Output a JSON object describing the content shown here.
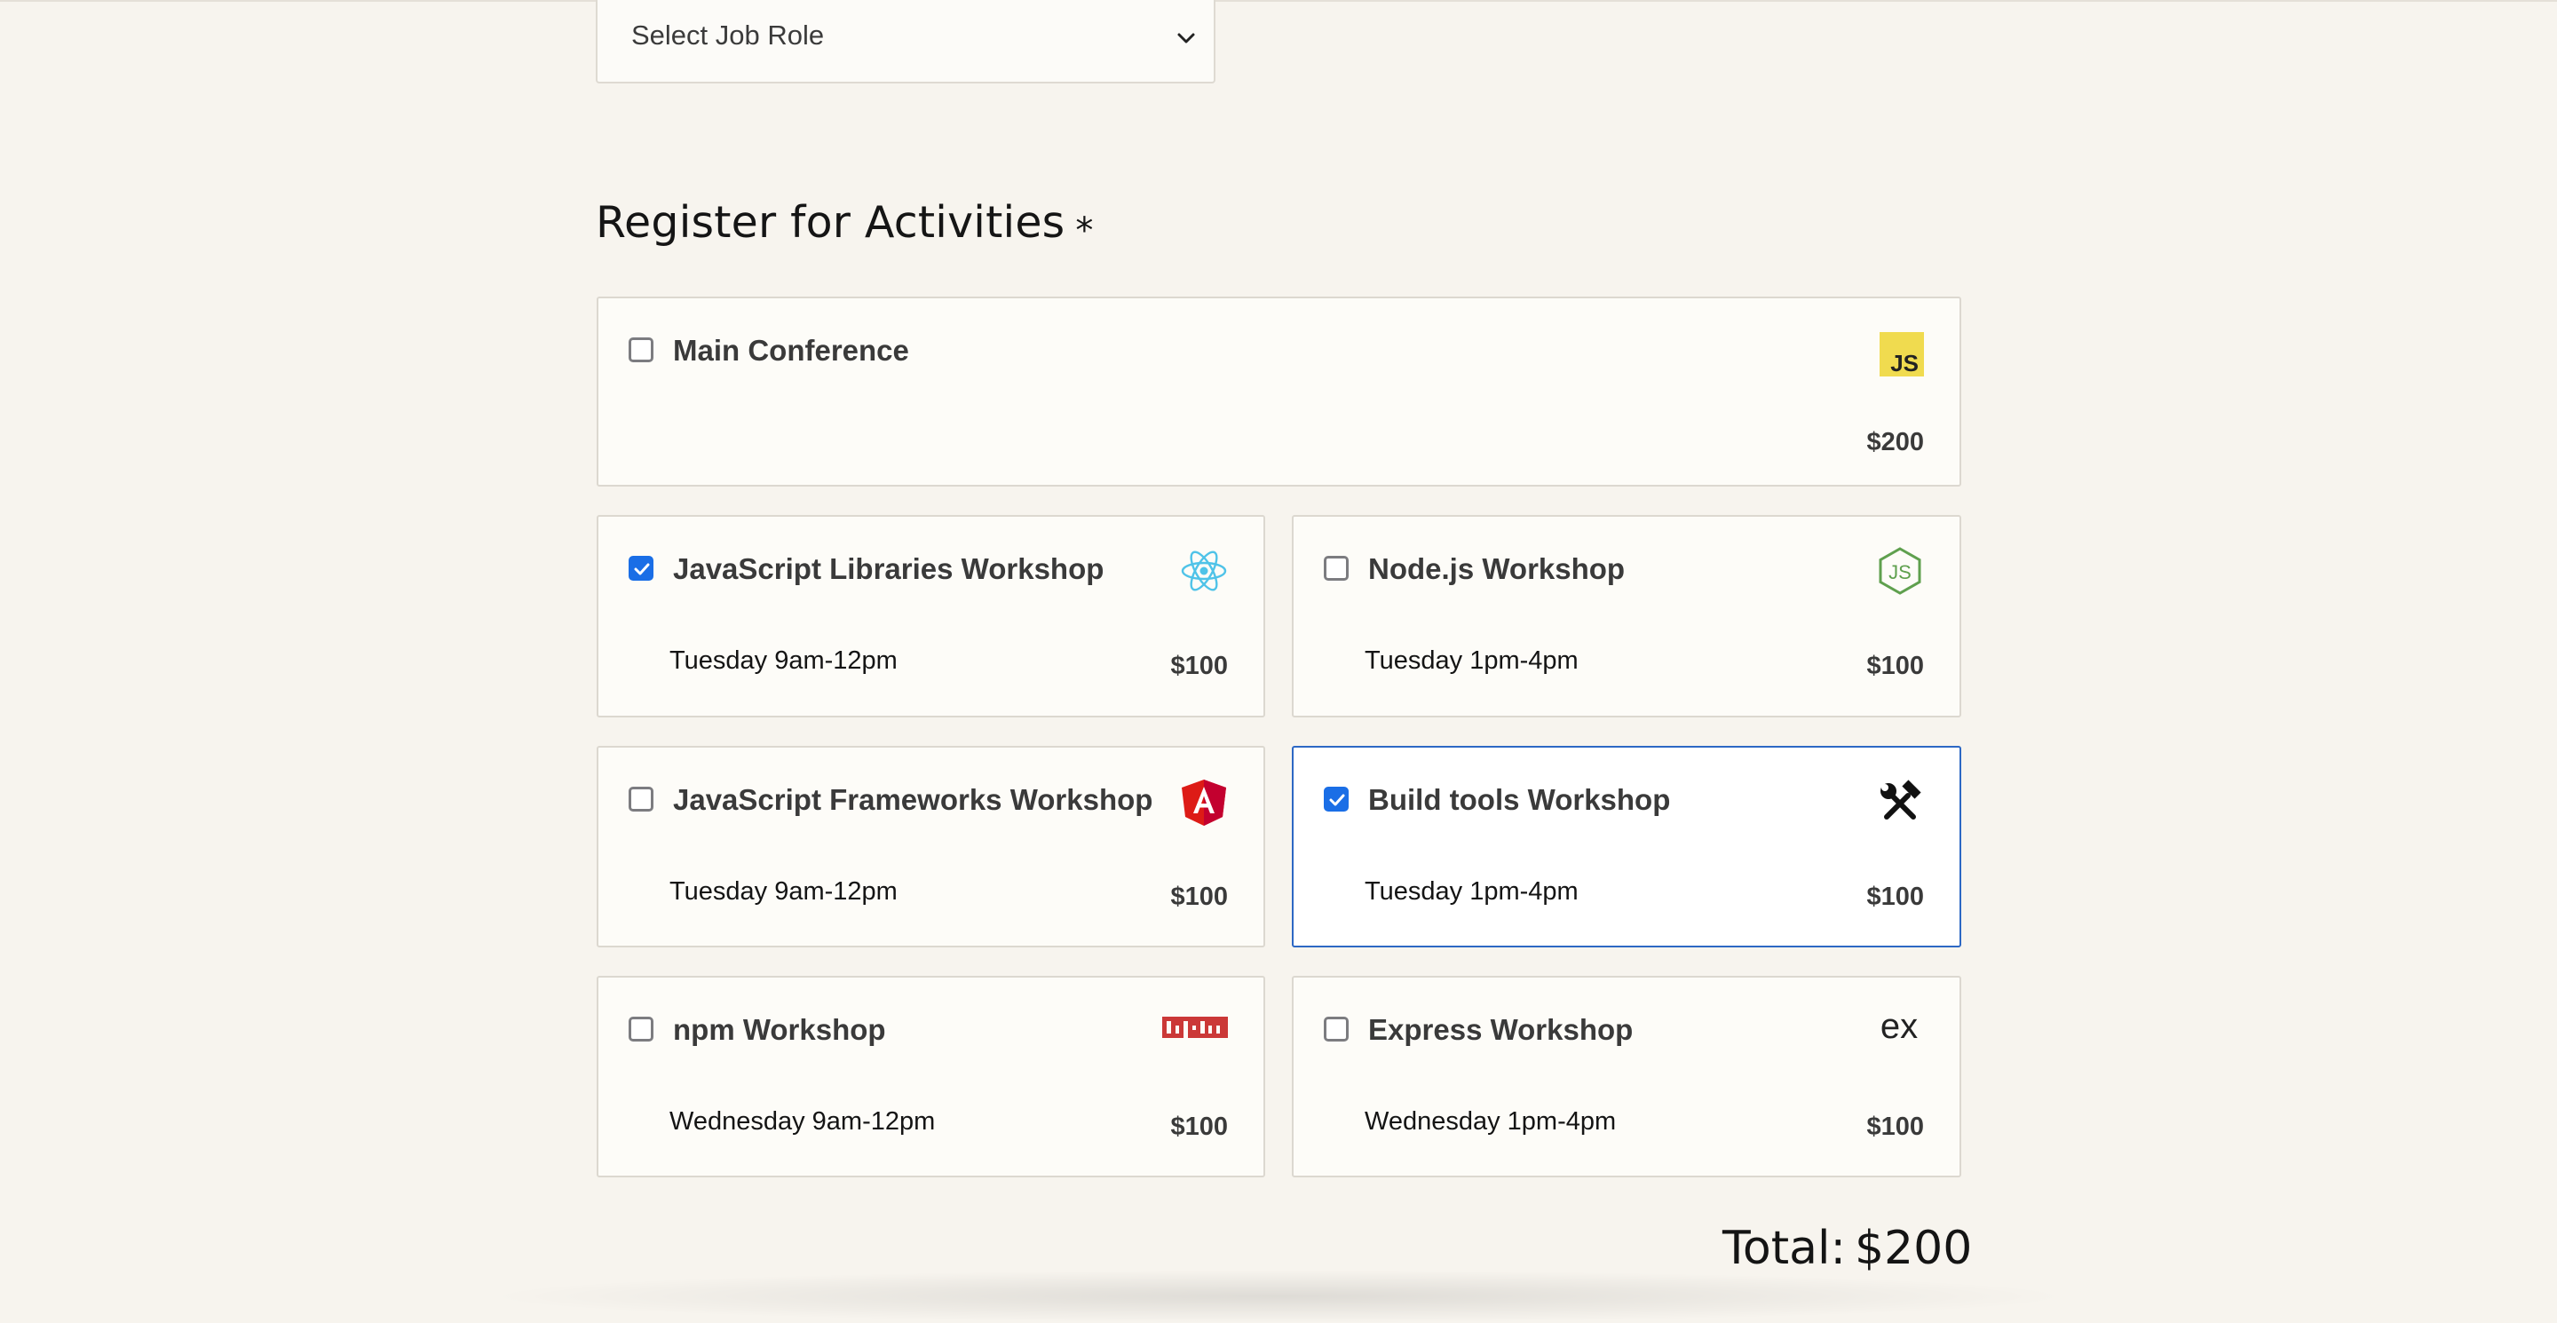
{
  "job_role": {
    "selected_label": "Select Job Role"
  },
  "activities": {
    "heading": "Register for Activities",
    "required_mark": "*",
    "main_conference": {
      "title": "Main Conference",
      "price": "$200",
      "checked": false,
      "icon": "javascript-icon"
    },
    "workshops": [
      {
        "title": "JavaScript Libraries Workshop",
        "time": "Tuesday 9am-12pm",
        "price": "$100",
        "checked": true,
        "icon": "react-icon"
      },
      {
        "title": "Node.js Workshop",
        "time": "Tuesday 1pm-4pm",
        "price": "$100",
        "checked": false,
        "icon": "nodejs-icon"
      },
      {
        "title": "JavaScript Frameworks Workshop",
        "time": "Tuesday 9am-12pm",
        "price": "$100",
        "checked": false,
        "icon": "angular-icon"
      },
      {
        "title": "Build tools Workshop",
        "time": "Tuesday 1pm-4pm",
        "price": "$100",
        "checked": true,
        "icon": "hammer-wrench-icon"
      },
      {
        "title": "npm Workshop",
        "time": "Wednesday 9am-12pm",
        "price": "$100",
        "checked": false,
        "icon": "npm-icon"
      },
      {
        "title": "Express Workshop",
        "time": "Wednesday 1pm-4pm",
        "price": "$100",
        "checked": false,
        "icon": "express-icon"
      }
    ],
    "total_label": "Total:",
    "total_value": "$200"
  },
  "colors": {
    "background": "#f7f4ee",
    "card": "#fdfcf8",
    "checkbox_checked": "#1a6ee6",
    "focus_border": "#2d68c4",
    "js_yellow": "#f0db4f",
    "react_cyan": "#61dafb",
    "node_green": "#5fa04e",
    "angular_red": "#dd1b16",
    "npm_red": "#cb3837"
  }
}
